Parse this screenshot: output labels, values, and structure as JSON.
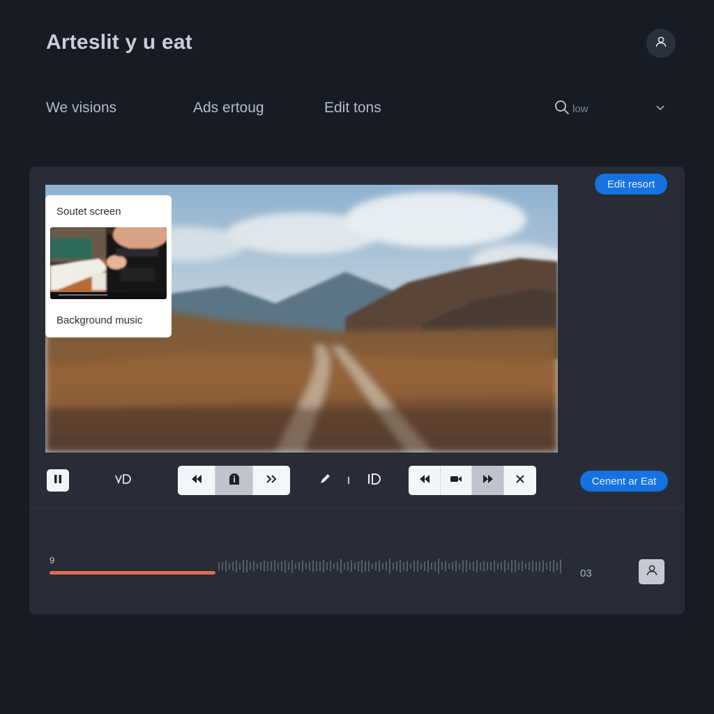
{
  "header": {
    "title": "Arteslit y u eat",
    "profile_icon": "user-icon"
  },
  "nav": {
    "items": [
      {
        "label": "We visions"
      },
      {
        "label": "Ads ertoug"
      },
      {
        "label": "Edit tons"
      }
    ],
    "search_value": "low"
  },
  "panel": {
    "edit_button": "Edit resort",
    "popup": {
      "title": "Soutet screen",
      "music_label": "Background music"
    },
    "generate_button": "Cenent ar Eat",
    "timeline": {
      "start_time": "9",
      "end_time": "03",
      "progress": 0.32
    }
  },
  "colors": {
    "accent": "#1572e0",
    "progress": "#e26a55",
    "background": "#171b23",
    "panel": "#272c36"
  }
}
